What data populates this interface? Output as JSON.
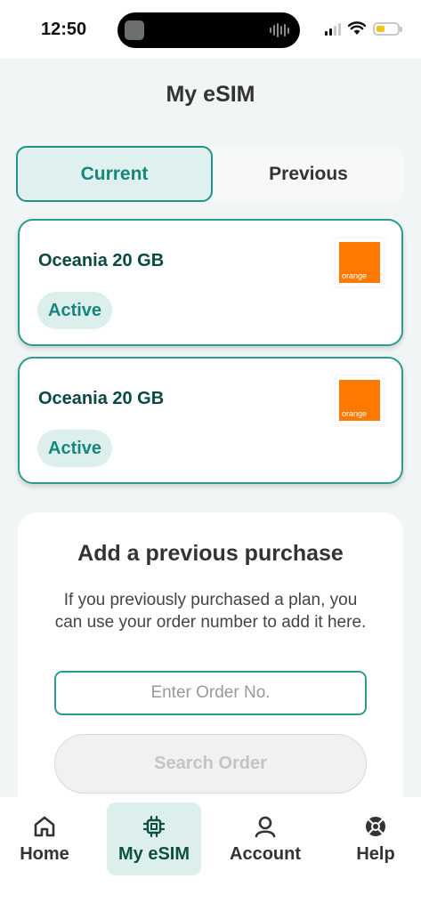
{
  "status_bar": {
    "time": "12:50"
  },
  "page": {
    "title": "My eSIM"
  },
  "tabs": {
    "current": "Current",
    "previous": "Previous",
    "selected": "Current"
  },
  "plans": [
    {
      "name": "Oceania 20 GB",
      "status": "Active",
      "carrier_logo_text": "orange"
    },
    {
      "name": "Oceania 20 GB",
      "status": "Active",
      "carrier_logo_text": "orange"
    }
  ],
  "add_purchase": {
    "title": "Add a previous purchase",
    "description": "If you previously purchased a plan, you can use your order number to add it here.",
    "input_value": "",
    "input_placeholder": "Enter Order No.",
    "button_label": "Search Order"
  },
  "bottom_nav": {
    "items": [
      {
        "label": "Home",
        "icon": "home-icon"
      },
      {
        "label": "My eSIM",
        "icon": "sim-chip-icon",
        "active": true
      },
      {
        "label": "Account",
        "icon": "user-icon"
      },
      {
        "label": "Help",
        "icon": "help-lifebuoy-icon"
      }
    ]
  },
  "colors": {
    "accent": "#2a9d8f",
    "accent_dark": "#16877c",
    "accent_light": "#dcefec",
    "background": "#f1f5f5",
    "carrier_orange": "#ff7900"
  }
}
